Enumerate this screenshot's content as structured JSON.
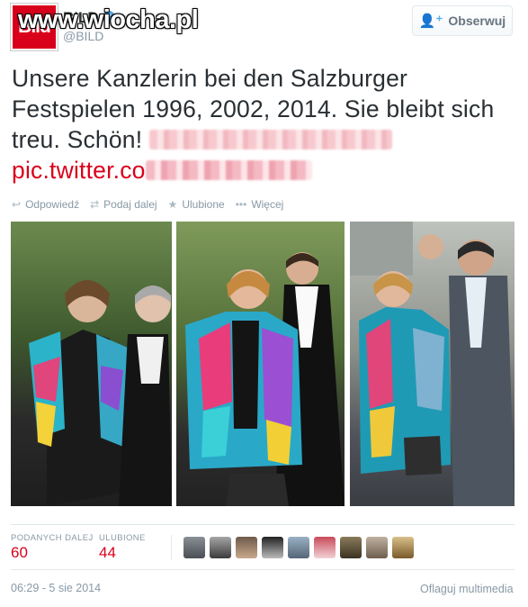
{
  "header": {
    "logo_text": "Bild",
    "display_name": "BILD",
    "handle": "@BILD",
    "watermark": "www.wiocha.pl",
    "follow_label": "Obserwuj"
  },
  "tweet": {
    "text": "Unsere Kanzlerin bei den Salzburger Festspielen 1996, 2002, 2014. Sie bleibt sich treu. Schön!",
    "link": "pic.twitter.co"
  },
  "actions": {
    "reply": "Odpowiedź",
    "retweet": "Podaj dalej",
    "favorite": "Ulubione",
    "more": "Więcej"
  },
  "stats": {
    "retweets_label": "PODANYCH DALEJ",
    "retweets": "60",
    "favorites_label": "ULUBIONE",
    "favorites": "44"
  },
  "footer": {
    "timestamp": "06:29 - 5 sie 2014",
    "flag_media": "Oflaguj multimedia"
  },
  "colors": {
    "brand": "#d9001b",
    "muted": "#8899a6",
    "verified": "#55acee"
  }
}
